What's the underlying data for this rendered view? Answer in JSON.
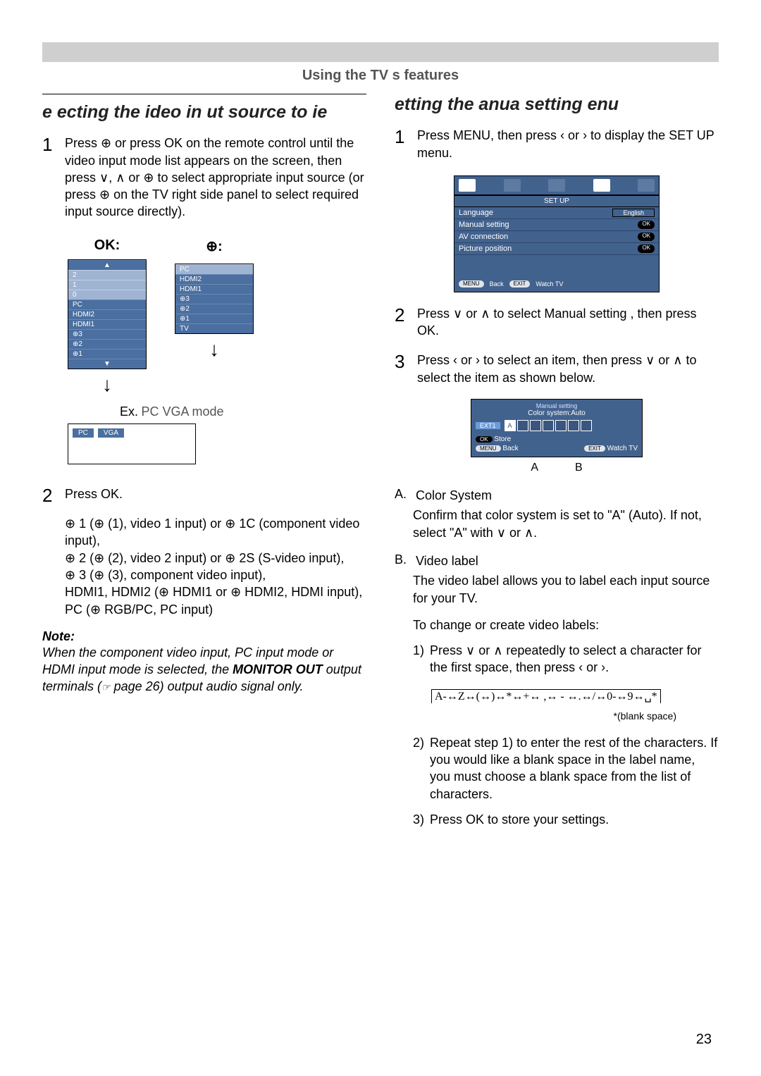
{
  "header": {
    "section_title": "Using the TV s features"
  },
  "left": {
    "title": "e ecting the  ideo in ut source to  ie",
    "step1": "Press ⊕ or press OK on the remote control until the video input mode list appears on the screen, then press ∨, ∧ or ⊕ to select appropriate input source (or press ⊕ on the TV right side panel to select required input source directly).",
    "g1": {
      "hdr_ok": "OK:",
      "hdr_inp": "⊕:",
      "list_a": [
        "▲",
        "2",
        "1",
        "0",
        "PC",
        "HDMI2",
        "HDMI1",
        "⊕3",
        "⊕2",
        "⊕1",
        "▼"
      ],
      "list_b": [
        "PC",
        "HDMI2",
        "HDMI1",
        "⊕3",
        "⊕2",
        "⊕1",
        "TV"
      ],
      "ex_label": "Ex.",
      "ex_mode": "PC VGA mode",
      "pc": "PC",
      "vga": "VGA"
    },
    "step2": "Press OK.",
    "inputs_block": "⊕ 1 (⊕ (1), video 1 input) or ⊕ 1C (component video input),\n⊕ 2 (⊕ (2), video 2 input) or ⊕ 2S (S-video input),\n⊕ 3 (⊕ (3), component video input),\nHDMI1, HDMI2 (⊕ HDMI1 or ⊕ HDMI2, HDMI input),\nPC (⊕ RGB/PC, PC input)",
    "note_label": "Note:",
    "note_body": "When the component video input, PC input mode or HDMI input mode is selected, the MONITOR OUT output terminals (☞ page 26) output audio signal only."
  },
  "right": {
    "title": "etting the  anua  setting  enu",
    "step1": "Press MENU, then press ‹ or › to display the SET UP menu.",
    "setup": {
      "title": "SET UP",
      "rows": [
        {
          "l": "Language",
          "r": "English",
          "kind": "box"
        },
        {
          "l": "Manual setting",
          "r": "OK",
          "kind": "pill"
        },
        {
          "l": "AV connection",
          "r": "OK",
          "kind": "pill"
        },
        {
          "l": "Picture position",
          "r": "OK",
          "kind": "pill"
        }
      ],
      "foot_menu": "MENU",
      "foot_back": "Back",
      "foot_exit": "EXIT",
      "foot_watch": "Watch TV"
    },
    "step2": "Press ∨ or ∧ to select Manual setting  , then press OK.",
    "step3": "Press ‹ or › to select an item, then press ∨ or ∧ to select the item as shown below.",
    "ms": {
      "title": "Manual setting",
      "sub": "Color system:Auto",
      "ext": "EXT1",
      "letter": "A",
      "ok": "OK",
      "store": "Store",
      "menu": "MENU",
      "back": "Back",
      "exit": "EXIT",
      "watch": "Watch TV",
      "lblA": "A",
      "lblB": "B"
    },
    "A_label": "A.",
    "A_title": "Color System",
    "A_body": "Confirm that color system is set to \"A\" (Auto). If not, select \"A\" with ∨ or ∧.",
    "B_label": "B.",
    "B_title": "Video label",
    "B_body": "The video label allows you to label each input source for your TV.",
    "B_change": "To change or create video labels:",
    "B1_num": "1)",
    "B1": "Press ∨ or ∧ repeatedly to select a character for the first space, then press ‹ or ›.",
    "char_seq": "A-↔Z↔(↔)↔*↔+↔ ,↔ - ↔.↔/↔0-↔9↔␣*",
    "blank_note": "*(blank space)",
    "B2_num": "2)",
    "B2": "Repeat step 1) to enter the rest of the characters. If you would like a blank space in the label name, you must choose a blank space from the list of characters.",
    "B3_num": "3)",
    "B3": "Press OK to store your settings."
  },
  "page_number": "23"
}
